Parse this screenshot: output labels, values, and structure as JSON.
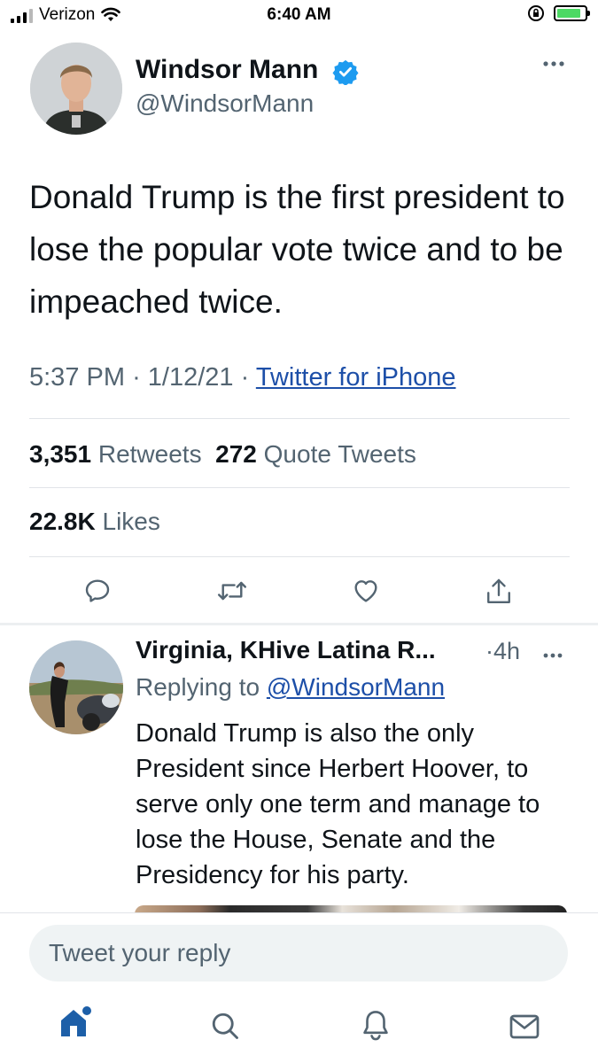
{
  "status_bar": {
    "carrier": "Verizon",
    "time": "6:40 AM",
    "battery_color": "#4cd964"
  },
  "tweet": {
    "author_name": "Windsor Mann",
    "handle": "@WindsorMann",
    "verified": true,
    "text": "Donald Trump is the first president to lose the popular vote twice and to be impeached twice.",
    "time": "5:37 PM",
    "date": "1/12/21",
    "separator": "·",
    "source": "Twitter for iPhone",
    "retweets_count": "3,351",
    "retweets_label": "Retweets",
    "quotes_count": "272",
    "quotes_label": "Quote Tweets",
    "likes_count": "22.8K",
    "likes_label": "Likes",
    "actions": [
      "reply-icon",
      "retweet-icon",
      "like-icon",
      "share-icon"
    ]
  },
  "reply": {
    "author_name": "Virginia, KHive Latina R...",
    "age": "·4h",
    "replying_label": "Replying to",
    "replying_to": "@WindsorMann",
    "text": "Donald Trump is also the only President since Herbert Hoover, to serve only one term and manage to lose the House, Senate and the Presidency for his party."
  },
  "composer": {
    "placeholder": "Tweet your reply"
  },
  "tab_bar": {
    "tabs": [
      "home-icon",
      "search-icon",
      "notifications-icon",
      "messages-icon"
    ],
    "accent": "#1d5fa8"
  }
}
